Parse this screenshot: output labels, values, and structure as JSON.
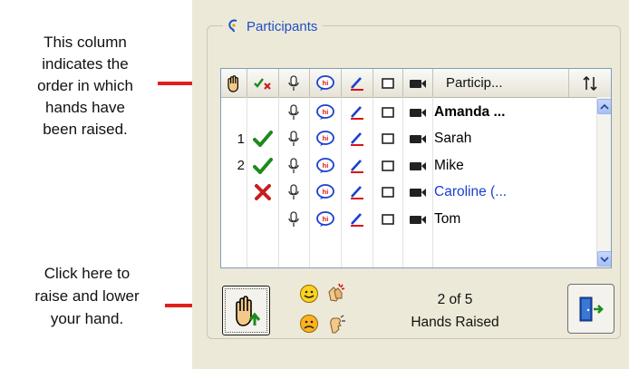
{
  "annotations": {
    "top_lines": [
      "This column",
      "indicates the",
      "order in which",
      "hands have",
      "been raised."
    ],
    "bottom_lines": [
      "Click here to",
      "raise and lower",
      "your hand."
    ]
  },
  "panel": {
    "title": "Participants",
    "name_header": "Particip...",
    "sort_icon": "sort-arrows-icon",
    "participants": [
      {
        "order": "",
        "status": "",
        "name": "Amanda ...",
        "style": "bold"
      },
      {
        "order": "1",
        "status": "checkmark-icon",
        "name": "Sarah",
        "style": "normal"
      },
      {
        "order": "2",
        "status": "checkmark-icon",
        "name": "Mike",
        "style": "normal"
      },
      {
        "order": "",
        "status": "x-mark-icon",
        "name": "Caroline (...",
        "style": "blue"
      },
      {
        "order": "",
        "status": "",
        "name": "Tom",
        "style": "normal"
      }
    ],
    "hands_count": "2 of 5",
    "hands_label": "Hands Raised"
  },
  "colors": {
    "arrow": "#e0201b",
    "check": "#1e8a1e",
    "xmark": "#c81e1e",
    "link_blue": "#1a3fcf",
    "panel_bg": "#ece9d8"
  }
}
